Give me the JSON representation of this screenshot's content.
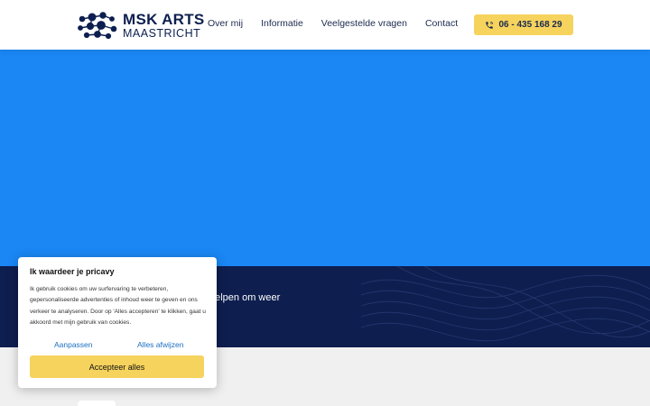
{
  "header": {
    "logo_title": "MSK ARTS",
    "logo_subtitle": "MAASTRICHT",
    "nav": [
      "Over mij",
      "Informatie",
      "Veelgestelde vragen",
      "Contact"
    ],
    "phone_label": "06 - 435 168 29",
    "phone_icon": "phone-icon"
  },
  "band": {
    "partial_text": "helpen om weer"
  },
  "cookie": {
    "title": "Ik waardeer je pricavy",
    "body": "Ik gebruik cookies om uw surfervaring te verbeteren, gepersonaliseerde advertenties of inhoud weer te geven en ons verkeer te analyseren. Door op 'Alles accepteren' te klikken, gaat u akkoord met mijn gebruik van cookies.",
    "customize_label": "Aanpassen",
    "reject_label": "Alles afwijzen",
    "accept_label": "Accepteer alles"
  },
  "colors": {
    "brand_navy": "#0e1e4f",
    "hero_blue": "#1a87f4",
    "accent_yellow": "#f6d35d",
    "link_blue": "#1b6fc2"
  }
}
